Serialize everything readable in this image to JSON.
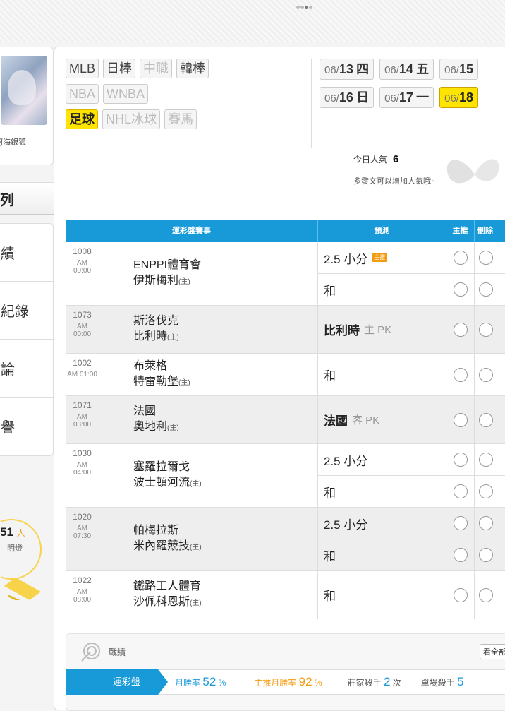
{
  "profile": {
    "nickname": "河海銀狐"
  },
  "sidebar": {
    "section_title": "列",
    "items": [
      {
        "label": "績"
      },
      {
        "label": "紀錄"
      },
      {
        "label": "論"
      },
      {
        "label": "譽"
      }
    ],
    "lamp": {
      "count": "51",
      "unit": "人",
      "text": "明燈"
    }
  },
  "sports": {
    "rows": [
      [
        {
          "label": "MLB",
          "state": "normal"
        },
        {
          "label": "日棒",
          "state": "normal"
        },
        {
          "label": "中職",
          "state": "muted"
        },
        {
          "label": "韓棒",
          "state": "normal"
        }
      ],
      [
        {
          "label": "NBA",
          "state": "muted"
        },
        {
          "label": "WNBA",
          "state": "muted"
        }
      ],
      [
        {
          "label": "足球",
          "state": "active"
        },
        {
          "label": "NHL冰球",
          "state": "muted"
        },
        {
          "label": "賽馬",
          "state": "muted"
        }
      ]
    ]
  },
  "dates": {
    "rows": [
      [
        {
          "prefix": "06/",
          "day": "13",
          "wd": "四"
        },
        {
          "prefix": "06/",
          "day": "14",
          "wd": "五"
        },
        {
          "prefix": "06/",
          "day": "15",
          "wd": ""
        }
      ],
      [
        {
          "prefix": "06/",
          "day": "16",
          "wd": "日"
        },
        {
          "prefix": "06/",
          "day": "17",
          "wd": "一"
        },
        {
          "prefix": "06/",
          "day": "18",
          "wd": "",
          "active": true
        }
      ]
    ]
  },
  "popularity": {
    "label": "今日人氣",
    "value": "6",
    "hint": "多發文可以增加人氣哦~"
  },
  "table": {
    "headers": {
      "event": "運彩盤賽事",
      "prediction": "預測",
      "main": "主推",
      "delete": "刪除"
    },
    "games": [
      {
        "id": "1008",
        "ampm": "AM",
        "time": "00:00",
        "home": "ENPPI體育會",
        "away": "伊斯梅利",
        "home_mark": "(主)",
        "shade": false,
        "preds": [
          {
            "text": "2.5 小分",
            "tag": "主推",
            "sub": "",
            "bold": false
          },
          {
            "text": "和",
            "sub": "",
            "bold": false
          }
        ]
      },
      {
        "id": "1073",
        "ampm": "AM",
        "time": "00:00",
        "home": "斯洛伐克",
        "away": "比利時",
        "home_mark": "(主)",
        "shade": true,
        "preds": [
          {
            "text": "比利時",
            "sub": "主 PK",
            "bold": true
          }
        ]
      },
      {
        "id": "1002",
        "ampm": "AM 01:00",
        "time": "",
        "home": "布萊格",
        "away": "特雷勒堡",
        "home_mark": "(主)",
        "shade": false,
        "preds": [
          {
            "text": "和",
            "sub": "",
            "bold": false
          }
        ]
      },
      {
        "id": "1071",
        "ampm": "AM",
        "time": "03:00",
        "home": "法國",
        "away": "奧地利",
        "home_mark": "(主)",
        "shade": true,
        "preds": [
          {
            "text": "法國",
            "sub": "客 PK",
            "bold": true
          }
        ]
      },
      {
        "id": "1030",
        "ampm": "AM",
        "time": "04:00",
        "home": "塞羅拉爾戈",
        "away": "波士頓河流",
        "home_mark": "(主)",
        "shade": false,
        "preds": [
          {
            "text": "2.5 小分",
            "sub": "",
            "bold": false
          },
          {
            "text": "和",
            "sub": "",
            "bold": false
          }
        ]
      },
      {
        "id": "1020",
        "ampm": "AM",
        "time": "07:30",
        "home": "帕梅拉斯",
        "away": "米內羅競技",
        "home_mark": "(主)",
        "shade": true,
        "preds": [
          {
            "text": "2.5 小分",
            "sub": "",
            "bold": false
          },
          {
            "text": "和",
            "sub": "",
            "bold": false
          }
        ]
      },
      {
        "id": "1022",
        "ampm": "AM",
        "time": "08:00",
        "home": "鐵路工人體育",
        "away": "沙佩科恩斯",
        "home_mark": "(主)",
        "shade": false,
        "preds": [
          {
            "text": "和",
            "sub": "",
            "bold": false
          }
        ]
      }
    ]
  },
  "stats": {
    "title": "戰績",
    "see_all": "看全部",
    "tab": "運彩盤",
    "month_win_label": "月勝率",
    "month_win": "52",
    "main_win_label": "主推月勝率",
    "main_win": "92",
    "pct": "%",
    "banker_label": "莊家殺手",
    "banker": "2",
    "banker_unit": "次",
    "single_label": "單場殺手",
    "single": "5"
  }
}
